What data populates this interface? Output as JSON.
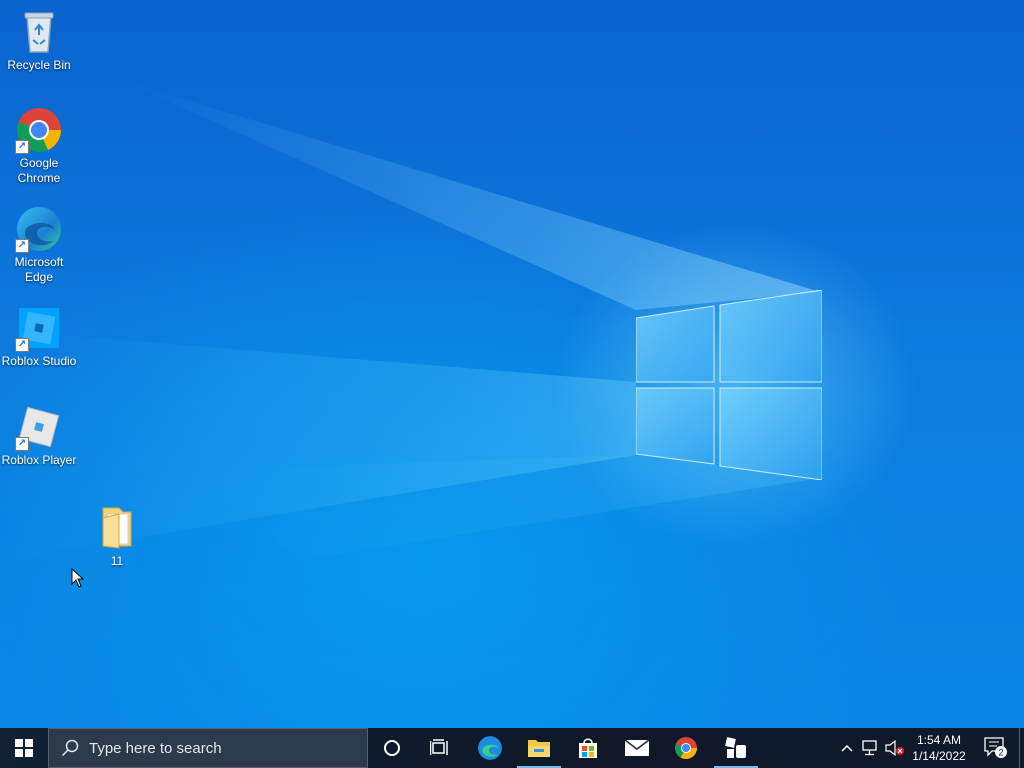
{
  "desktop": {
    "icons": [
      {
        "label": "Recycle Bin",
        "icon": "recycle-bin-icon",
        "shortcut": false
      },
      {
        "label": "Google Chrome",
        "icon": "chrome-icon",
        "shortcut": true
      },
      {
        "label": "Microsoft Edge",
        "icon": "edge-icon",
        "shortcut": true
      },
      {
        "label": "Roblox Studio",
        "icon": "roblox-studio-icon",
        "shortcut": true
      },
      {
        "label": "Roblox Player",
        "icon": "roblox-player-icon",
        "shortcut": true
      },
      {
        "label": "11",
        "icon": "folder-icon",
        "shortcut": false
      }
    ]
  },
  "taskbar": {
    "search_placeholder": "Type here to search",
    "pinned_apps": [
      {
        "name": "cortana",
        "icon": "cortana-icon"
      },
      {
        "name": "task-view",
        "icon": "task-view-icon"
      },
      {
        "name": "edge",
        "icon": "edge-icon"
      },
      {
        "name": "file-explorer",
        "icon": "folder-icon",
        "active": true
      },
      {
        "name": "microsoft-store",
        "icon": "store-icon"
      },
      {
        "name": "mail",
        "icon": "mail-icon"
      },
      {
        "name": "chrome",
        "icon": "chrome-icon"
      },
      {
        "name": "roblox-studio",
        "icon": "roblox-studio-icon",
        "active": true
      }
    ],
    "clock": {
      "time": "1:54 AM",
      "date": "1/14/2022"
    },
    "notification_count": "2"
  },
  "colors": {
    "accent": "#76b9ed",
    "taskbar": "#0e1827",
    "desktop_blue": "#0c7ee0"
  }
}
